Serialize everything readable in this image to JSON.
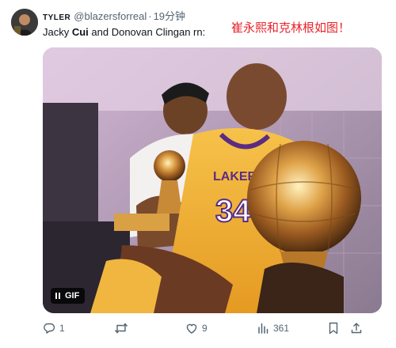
{
  "tweet": {
    "display_name": "TYLER",
    "handle": "@blazersforreal",
    "separator": "·",
    "time": "19分钟",
    "text_before": "Jacky ",
    "text_bold": "Cui",
    "text_after": " and Donovan Clingan rn:",
    "annotation": "崔永熙和克林根如图！"
  },
  "media": {
    "badge_label": "GIF",
    "jersey_team": "LAKERS",
    "jersey_number": "34"
  },
  "actions": {
    "reply_count": "1",
    "retweet_count": "",
    "like_count": "9",
    "view_count": "361"
  },
  "colors": {
    "text_primary": "#0f1419",
    "text_secondary": "#536471",
    "annotation_red": "#e8232a",
    "jersey_gold": "#f2b63a",
    "jersey_purple": "#5a2d82"
  }
}
